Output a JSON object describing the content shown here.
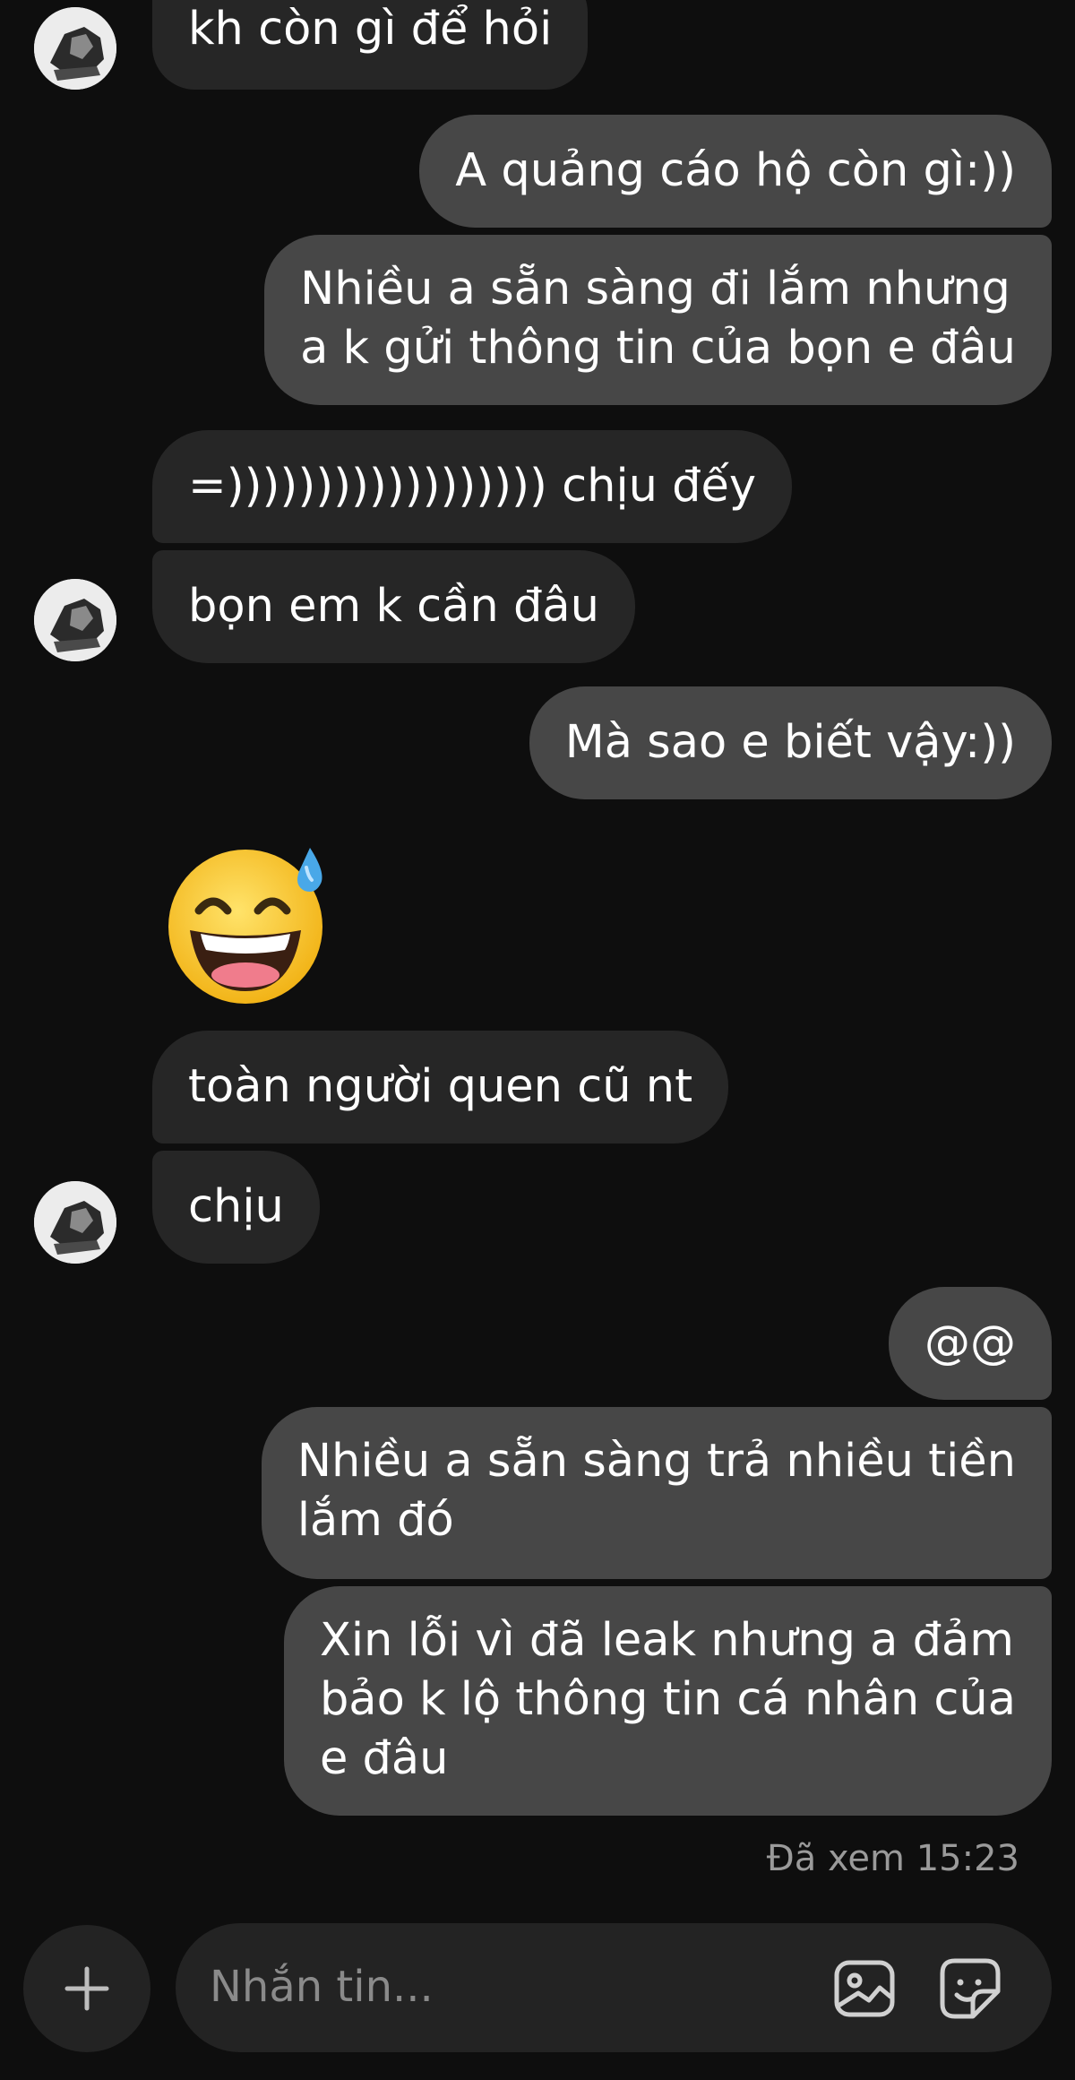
{
  "messages": {
    "m1": "kh còn gì để hỏi",
    "m2": "A quảng cáo hộ còn gì:))",
    "m3": [
      "Nhiều a sẵn sàng đi lắm nhưng",
      "a k gửi thông tin của bọn e đâu"
    ],
    "m4": "=)))))))))))))))))) chịu đếy",
    "m5": "bọn em k cần đâu",
    "m6": "Mà sao e biết vậy:))",
    "m7": "😅",
    "m8": "toàn người quen cũ nt",
    "m9": "chịu",
    "m10": "@@",
    "m11": [
      "Nhiều a sẵn sàng trả nhiều tiền",
      "lắm đó"
    ],
    "m12": [
      "Xin lỗi vì đã leak nhưng a đảm",
      "bảo k lộ thông tin cá nhân của",
      "e đâu"
    ]
  },
  "seen": "Đã xem 15:23",
  "composer": {
    "placeholder": "Nhắn tin...",
    "plus_icon": "plus-icon",
    "gallery_icon": "image-icon",
    "sticker_icon": "sticker-icon"
  },
  "colors": {
    "background": "#0e0e0e",
    "incoming_bubble": "#262626",
    "outgoing_bubble": "#474747",
    "composer": "#232323",
    "muted_text": "#9a9a9a"
  }
}
